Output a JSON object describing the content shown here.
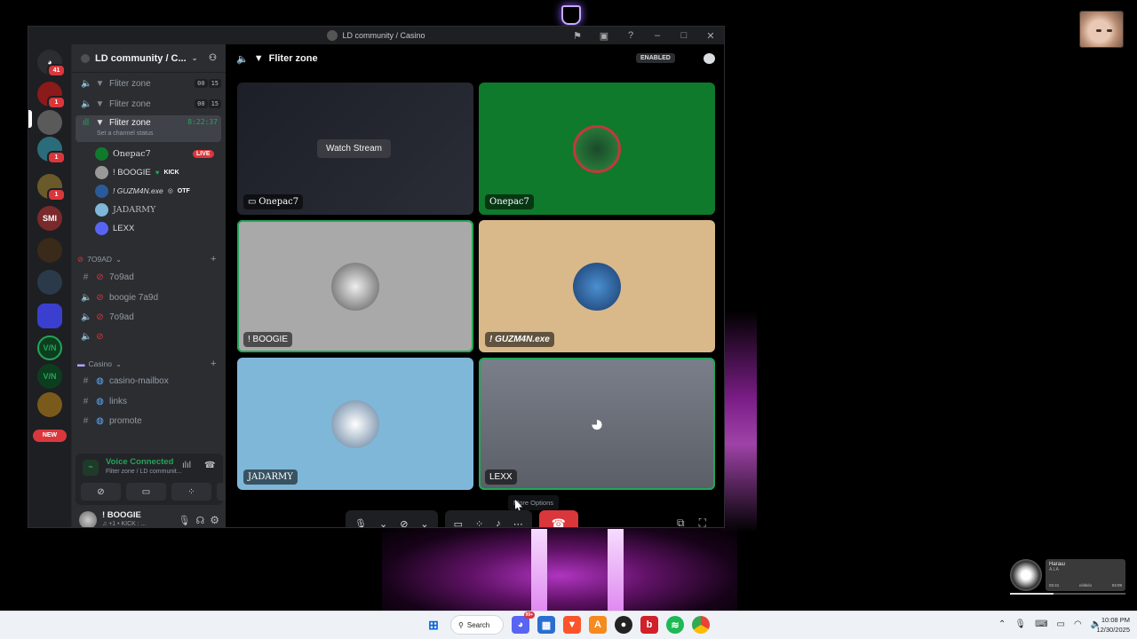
{
  "window": {
    "title": "LD community / Casino",
    "controls": {
      "minimize": "–",
      "maximize": "□",
      "close": "✕"
    }
  },
  "servers": {
    "home_badge": "41",
    "items": [
      {
        "badge": "1"
      },
      {
        "badge": ""
      },
      {
        "badge": "1"
      },
      {
        "badge": "1"
      },
      {
        "label": "SMI"
      },
      {
        "label": ""
      },
      {
        "label": ""
      },
      {
        "label": ""
      },
      {
        "label": "V/N"
      },
      {
        "label": "V/N"
      }
    ],
    "new_label": "NEW"
  },
  "sidebar": {
    "guild_name": "LD community / C...",
    "voice_channels": [
      {
        "name": "Fliter zone",
        "counter_a": "00",
        "counter_b": "15"
      },
      {
        "name": "Fliter zone",
        "counter_a": "00",
        "counter_b": "15"
      },
      {
        "name": "Fliter zone",
        "timer": "8:22:37",
        "status": "Set a channel status"
      }
    ],
    "voice_users": [
      {
        "name": "Onepac7",
        "tag": "LIVE"
      },
      {
        "name": "! BOOGIE",
        "tag": "KICK"
      },
      {
        "name": "! GUZM4N.exe",
        "tag": "OTF"
      },
      {
        "name": "JADARMY",
        "tag": ""
      },
      {
        "name": "LEXX",
        "tag": ""
      }
    ],
    "category_1": "7O9AD",
    "channels_1": [
      {
        "name": "7o9ad"
      },
      {
        "name": "boogie 7a9d"
      },
      {
        "name": "7o9ad"
      },
      {
        "name": ""
      }
    ],
    "category_2": "Casino",
    "channels_2": [
      {
        "name": "casino-mailbox"
      },
      {
        "name": "links"
      },
      {
        "name": "promote"
      }
    ]
  },
  "voice_panel": {
    "status": "Voice Connected",
    "location": "Fliter zone / LD communit..."
  },
  "user": {
    "name": "! BOOGIE",
    "sub": "♫ +1 • KICK : ..."
  },
  "call": {
    "channel_name": "Fliter zone",
    "enabled_label": "ENABLED",
    "watch_stream": "Watch Stream",
    "tiles": [
      {
        "name": "Onepac7",
        "bg": "#1e1f26"
      },
      {
        "name": "Onepac7",
        "bg": "#0f7a2b"
      },
      {
        "name": "! BOOGIE",
        "bg": "#a9a9a9"
      },
      {
        "name": "! GUZM4N.exe",
        "bg": "#d9b98a"
      },
      {
        "name": "JADARMY",
        "bg": "#7fb7d9"
      },
      {
        "name": "LEXX",
        "bg": "#6f7480"
      }
    ],
    "more_options_tip": "More Options"
  },
  "music_widget": {
    "title": "Нагаш",
    "artist": "A.I.A",
    "elapsed": "02:41",
    "total": "04:09",
    "progress": 0.38
  },
  "taskbar": {
    "search_label": "Search",
    "discord_badge": "99+",
    "time": "10:08 PM",
    "date": "12/30/2025"
  },
  "colors": {
    "accent_green": "#23a55a",
    "danger_red": "#da373c",
    "bg_dark": "#1e1f22"
  }
}
